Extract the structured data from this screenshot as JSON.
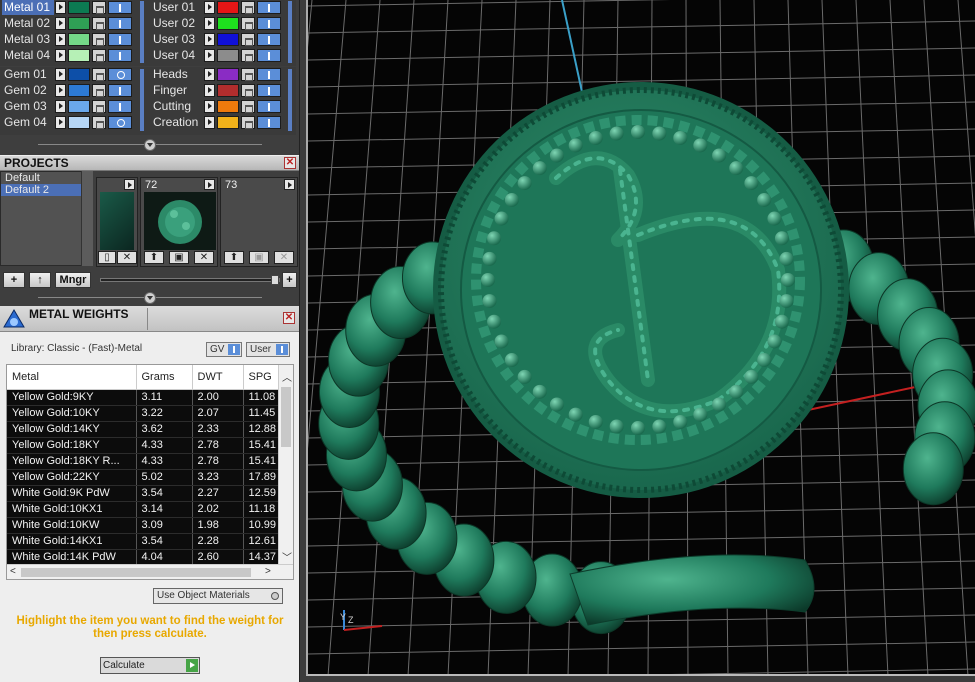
{
  "materials": {
    "metals": [
      "Metal 01",
      "Metal 02",
      "Metal 03",
      "Metal 04"
    ],
    "metal_colors": [
      "#0c7a52",
      "#2f9f55",
      "#74d888",
      "#b6f0b6"
    ],
    "users": [
      "User 01",
      "User 02",
      "User 03",
      "User 04"
    ],
    "user_colors": [
      "#e51616",
      "#1ee01e",
      "#1010d8",
      "#8c8c8c"
    ],
    "gems": [
      "Gem 01",
      "Gem 02",
      "Gem 03",
      "Gem 04"
    ],
    "gem_colors": [
      "#0d4fa8",
      "#2d7ad4",
      "#6aa8ec",
      "#b6d6f6"
    ],
    "layers": [
      "Heads",
      "Finger",
      "Cutting",
      "Creation"
    ],
    "layer_colors": [
      "#8a2cc4",
      "#b22d2d",
      "#ee7a0c",
      "#f2b21a"
    ]
  },
  "projects": {
    "title": "PROJECTS",
    "list": [
      "Default",
      "Default 2"
    ],
    "thumbs": [
      "",
      "72",
      "73"
    ],
    "buttons": {
      "add": "+",
      "up": "↑",
      "manager": "Mngr",
      "plus": "+"
    }
  },
  "metal_weights": {
    "title": "METAL WEIGHTS",
    "library": "Library: Classic - (Fast)-Metal",
    "gv_label": "GV",
    "user_label": "User",
    "columns": [
      "Metal",
      "Grams",
      "DWT",
      "SPG"
    ],
    "rows": [
      [
        "Yellow Gold:9KY",
        "3.11",
        "2.00",
        "11.08"
      ],
      [
        "Yellow Gold:10KY",
        "3.22",
        "2.07",
        "11.45"
      ],
      [
        "Yellow Gold:14KY",
        "3.62",
        "2.33",
        "12.88"
      ],
      [
        "Yellow Gold:18KY",
        "4.33",
        "2.78",
        "15.41"
      ],
      [
        "Yellow Gold:18KY R...",
        "4.33",
        "2.78",
        "15.41"
      ],
      [
        "Yellow Gold:22KY",
        "5.02",
        "3.23",
        "17.89"
      ],
      [
        "White Gold:9K PdW",
        "3.54",
        "2.27",
        "12.59"
      ],
      [
        "White Gold:10KX1",
        "3.14",
        "2.02",
        "11.18"
      ],
      [
        "White Gold:10KW",
        "3.09",
        "1.98",
        "10.99"
      ],
      [
        "White Gold:14KX1",
        "3.54",
        "2.28",
        "12.61"
      ],
      [
        "White Gold:14K PdW",
        "4.04",
        "2.60",
        "14.37"
      ]
    ],
    "use_object_materials": "Use Object Materials",
    "hint": "Highlight the item you want to find the weight for then press calculate.",
    "calculate": "Calculate"
  },
  "viewport": {
    "background": "#050505",
    "grid_color": "#6b6b6b",
    "model_color": "#1f7a5c",
    "axis": {
      "y": "Y",
      "z": "Z"
    }
  }
}
